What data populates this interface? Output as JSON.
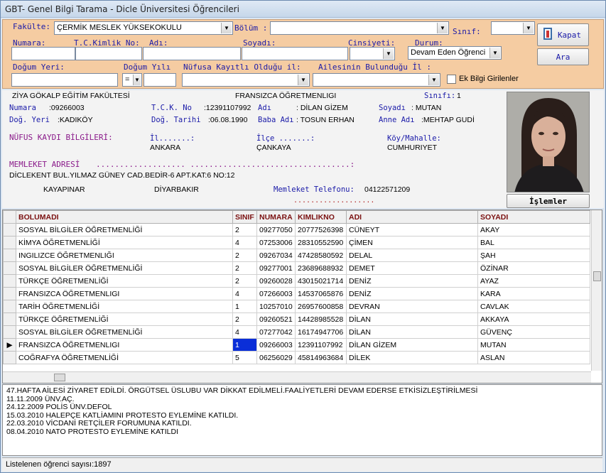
{
  "window": {
    "title": "GBT- Genel Bilgi Tarama - Dicle Üniversitesi Öğrencileri"
  },
  "filter": {
    "fakulte_label": "Fakülte:",
    "fakulte_value": "ÇERMİK MESLEK YÜKSEKOKULU",
    "bolum_label": "Bölüm :",
    "bolum_value": "",
    "sinif_label": "Sınıf:",
    "sinif_value": "",
    "numara_label": "Numara:",
    "numara_value": "",
    "tckn_label": "T.C.Kimlik No:",
    "tckn_value": "",
    "adi_label": "Adı:",
    "adi_value": "",
    "soyadi_label": "Soyadı:",
    "soyadi_value": "",
    "cinsiyet_label": "Cinsiyeti:",
    "cinsiyet_value": "",
    "durum_label": "Durum:",
    "durum_value": "Devam Eden Öğrenci",
    "dogum_yeri_label": "Doğum Yeri:",
    "dogum_yeri_value": "",
    "dogum_yili_label": "Doğum Yılı",
    "dogum_yili_op": "=",
    "dogum_yili_value": "",
    "nufus_il_label": "Nüfusa Kayıtlı Olduğu il:",
    "nufus_il_value": "",
    "aile_il_label": "Ailesinin Bulunduğu İl :",
    "aile_il_value": "",
    "ek_bilgi_label": "Ek Bilgi Girilenler",
    "kapat_label": "Kapat",
    "ara_label": "Ara"
  },
  "student": {
    "fakulte": "ZİYA GÖKALP EĞİTİM FAKÜLTESİ",
    "bolum": "FRANSIZCA ÖĞRETMENLIGI",
    "sinif_label": "Sınıfı:",
    "sinif": "1",
    "numara_label": "Numara",
    "numara": ":09266003",
    "tckn_label": "T.C.K. No",
    "tckn": ":12391107992",
    "adi_label": "Adı",
    "adi": ": DİLAN GİZEM",
    "soyadi_label": "Soyadı",
    "soyadi": ": MUTAN",
    "dog_yeri_label": "Doğ. Yeri",
    "dog_yeri": ":KADIKÖY",
    "dog_tarihi_label": "Doğ. Tarihi",
    "dog_tarihi": ":06.08.1990",
    "baba_label": "Baba Adı",
    "baba": ": TOSUN ERHAN",
    "anne_label": "Anne Adı",
    "anne": ":MEHTAP GUDİ",
    "nufus_title": "NÜFUS KAYDI BİLGİLERİ:",
    "il_label": "İl.......:",
    "il": "ANKARA",
    "ilce_label": "İlçe .......:",
    "ilce": "ÇANKAYA",
    "koy_label": "Köy/Mahalle:",
    "koy": "CUMHURIYET",
    "memleket_title": "MEMLEKET ADRESİ",
    "memleket_dots": "................... ..................................:",
    "adres": "DİCLEKENT BUL.YILMAZ GÜNEY CAD.BEDİR-6 APT.KAT:6 NO:12",
    "adres_ilce": "KAYAPINAR",
    "adres_il": "DİYARBAKIR",
    "tel_label": "Memleket Telefonu:",
    "tel": "04122571209",
    "tel_dots": "...................",
    "islemler_label": "İşlemler"
  },
  "grid": {
    "columns": [
      "BOLUMADI",
      "SINIF",
      "NUMARA",
      "KIMLIKNO",
      "ADI",
      "SOYADI"
    ],
    "rows": [
      [
        "SOSYAL BİLGİLER ÖĞRETMENLİĞİ",
        "2",
        "09277050",
        "20777526398",
        "CÜNEYT",
        "AKAY"
      ],
      [
        "KİMYA ÖĞRETMENLİĞİ",
        "4",
        "07253006",
        "28310552590",
        "ÇİMEN",
        "BAL"
      ],
      [
        "INGILIZCE ÖĞRETMENLIĞI",
        "2",
        "09267034",
        "47428580592",
        "DELAL",
        "ŞAH"
      ],
      [
        "SOSYAL BİLGİLER ÖĞRETMENLİĞİ",
        "2",
        "09277001",
        "23689688932",
        "DEMET",
        "ÖZİNAR"
      ],
      [
        "TÜRKÇE ÖĞRETMENLİĞİ",
        "2",
        "09260028",
        "43015021714",
        "DENİZ",
        "AYAZ"
      ],
      [
        "FRANSIZCA ÖĞRETMENLIGI",
        "4",
        "07266003",
        "14537065876",
        "DENİZ",
        "KARA"
      ],
      [
        "TARİH ÖĞRETMENLİĞİ",
        "1",
        "10257010",
        "26957600858",
        "DEVRAN",
        "CAVLAK"
      ],
      [
        "TÜRKÇE ÖĞRETMENLİĞİ",
        "2",
        "09260521",
        "14428985528",
        "DİLAN",
        "AKKAYA"
      ],
      [
        "SOSYAL BİLGİLER ÖĞRETMENLİĞİ",
        "4",
        "07277042",
        "16174947706",
        "DİLAN",
        "GÜVENÇ"
      ],
      [
        "FRANSIZCA ÖĞRETMENLIGI",
        "1",
        "09266003",
        "12391107992",
        "DİLAN GİZEM",
        "MUTAN"
      ],
      [
        "COĞRAFYA ÖĞRETMENLİĞİ",
        "5",
        "06256029",
        "45814963684",
        "DİLEK",
        "ASLAN"
      ]
    ],
    "selected_row": 9
  },
  "notes": [
    "47.HAFTA AİLESİ ZİYARET EDİLDİ. ÖRGÜTSEL ÜSLUBU VAR DİKKAT EDİLMELİ.FAALİYETLERİ DEVAM EDERSE ETKİSİZLEŞTİRİLMESİ",
    "11.11.2009 ÜNV.AÇ.",
    "24.12.2009 POLİS ÜNV.DEFOL",
    "15.03.2010 HALEPÇE KATLİAMINI PROTESTO EYLEMİNE KATILDI.",
    "22.03.2010 VİCDANİ RETÇİLER FORUMUNA KATILDI.",
    "08.04.2010 NATO PROTESTO EYLEMİNE KATILDI"
  ],
  "status": "Listelenen öğrenci sayısı:1897"
}
